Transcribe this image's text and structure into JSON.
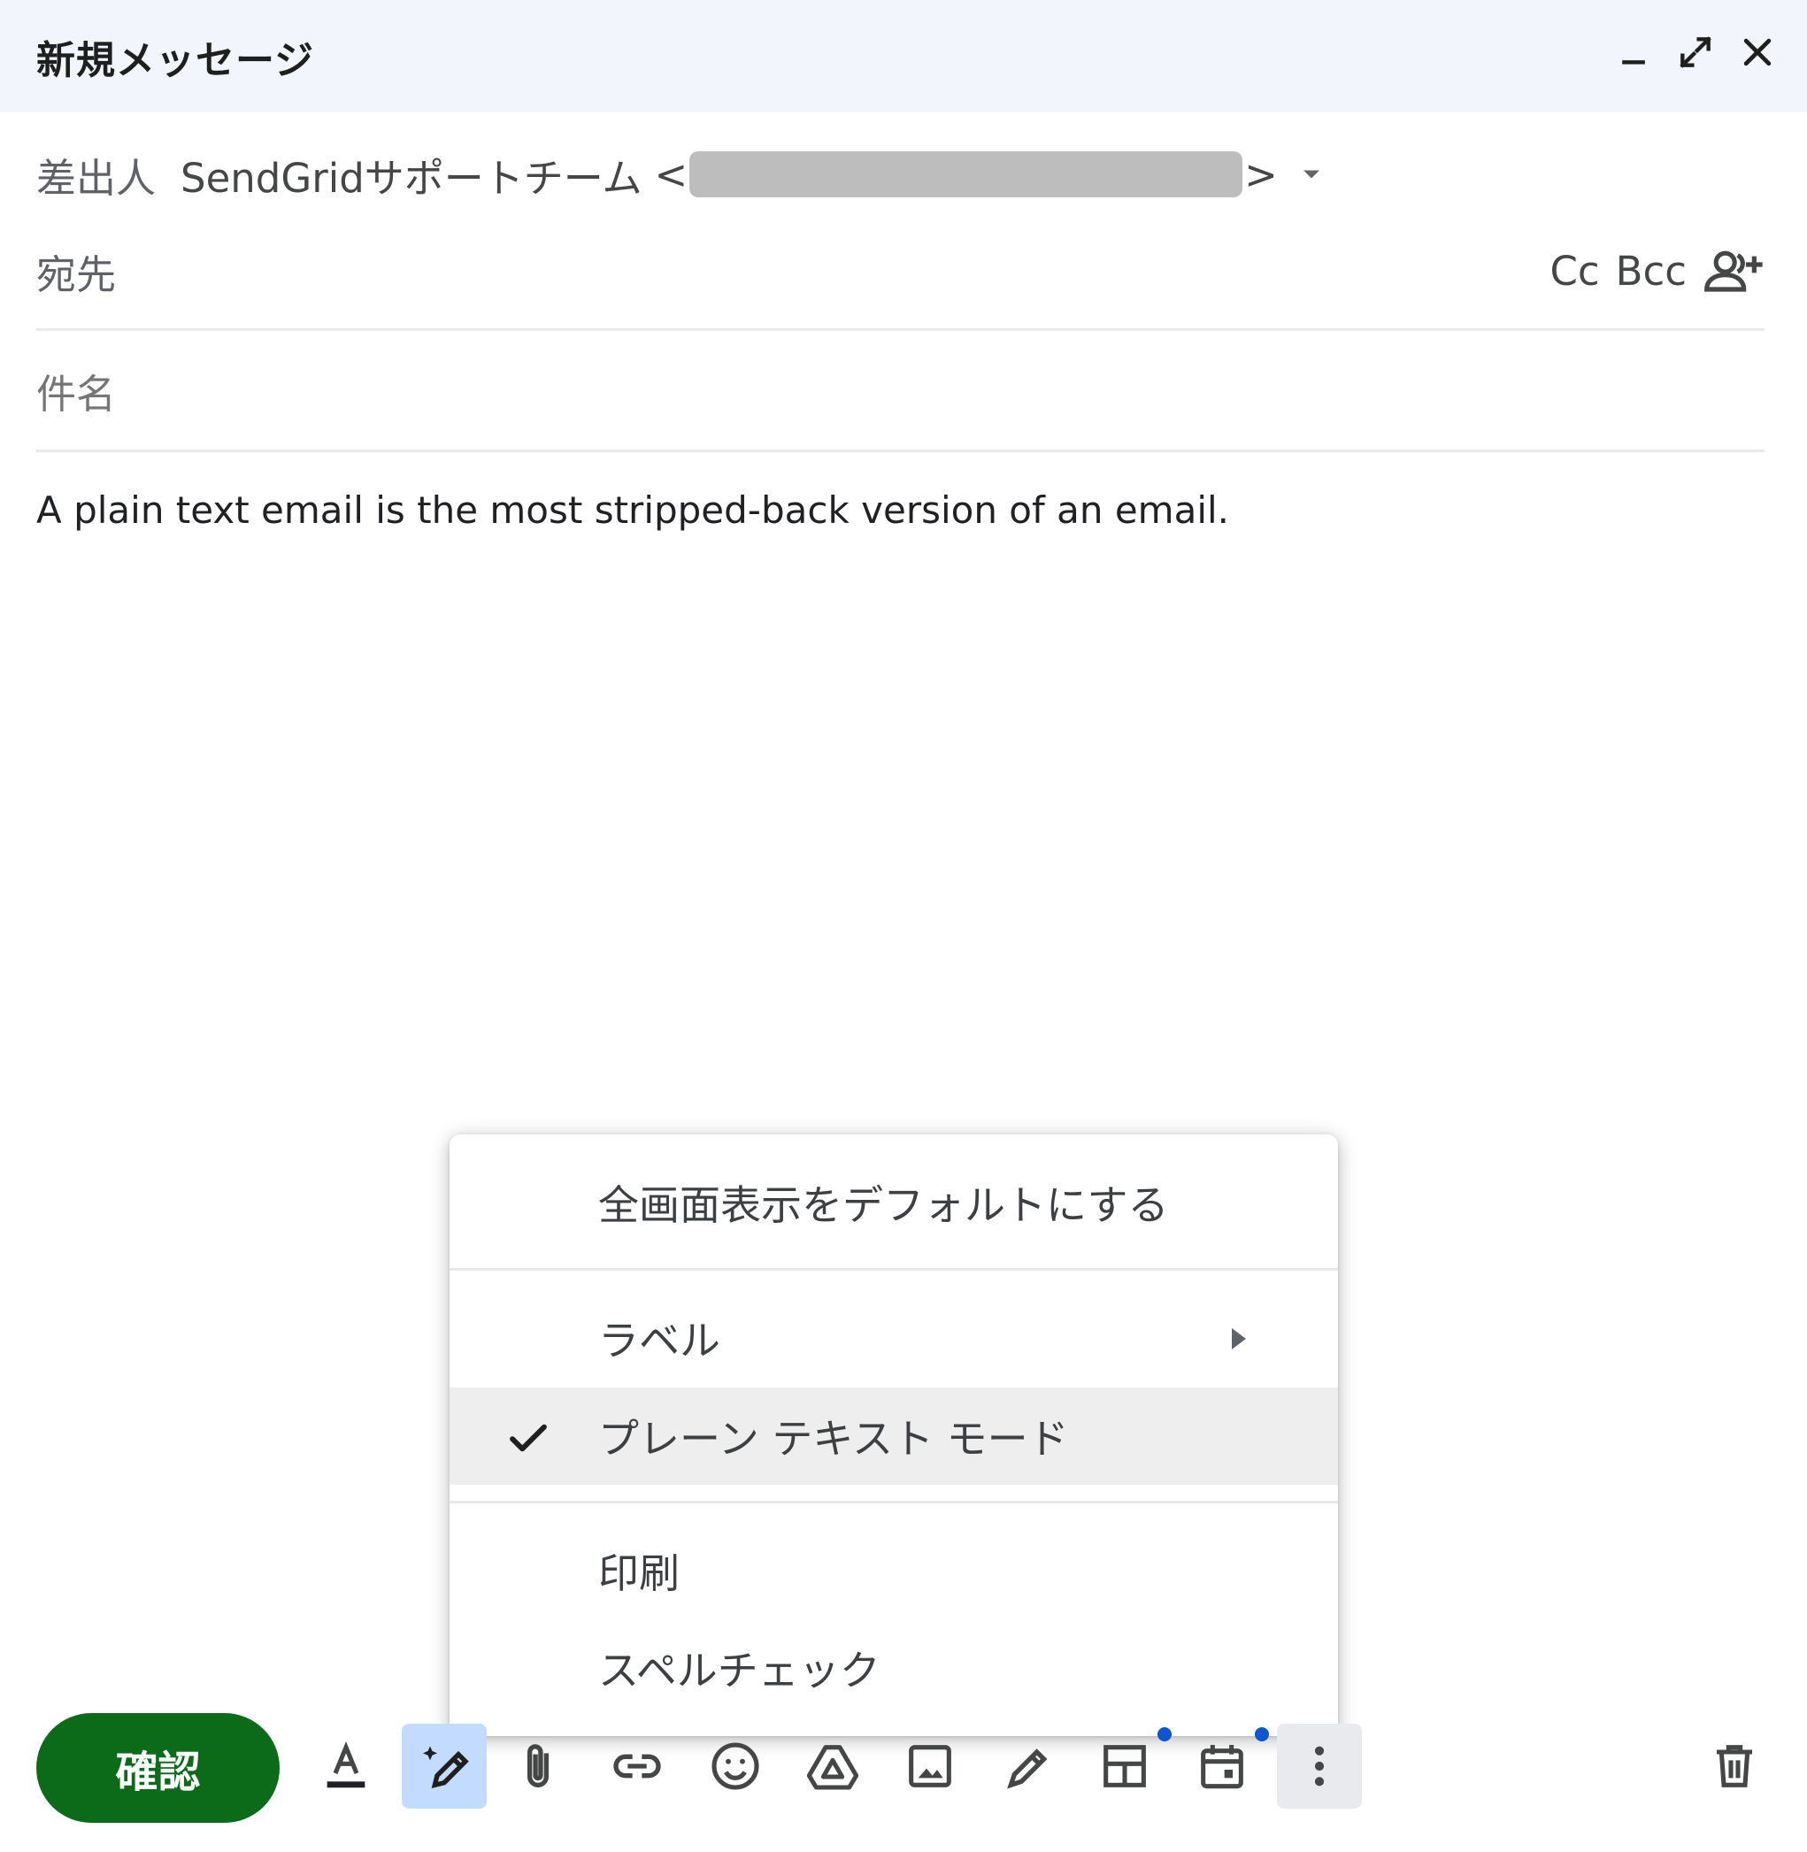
{
  "window": {
    "title": "新規メッセージ",
    "minimize_icon": "minimize-icon",
    "expand_icon": "expand-icon",
    "close_icon": "close-icon"
  },
  "compose": {
    "from_label": "差出人",
    "from_name": "SendGridサポートチーム",
    "from_open": "<",
    "from_close": ">",
    "to_label": "宛先",
    "cc_label": "Cc",
    "bcc_label": "Bcc",
    "subject_label": "件名",
    "body": "A plain text email is the most stripped-back version of an email."
  },
  "menu": {
    "items": [
      {
        "label": "全画面表示をデフォルトにする"
      },
      {
        "label": "ラベル"
      },
      {
        "label": "プレーン テキスト モード",
        "checked": true
      },
      {
        "label": "印刷"
      },
      {
        "label": "スペルチェック"
      }
    ]
  },
  "toolbar": {
    "send_label": "確認",
    "accent_color": "#0b6b19",
    "active_bg": "#c2dbff",
    "icons": [
      "text-format-icon",
      "ai-pen-icon",
      "attach-icon",
      "link-icon",
      "emoji-icon",
      "drive-icon",
      "image-icon",
      "signature-icon",
      "template-icon",
      "schedule-icon",
      "more-options-icon",
      "trash-icon"
    ]
  }
}
